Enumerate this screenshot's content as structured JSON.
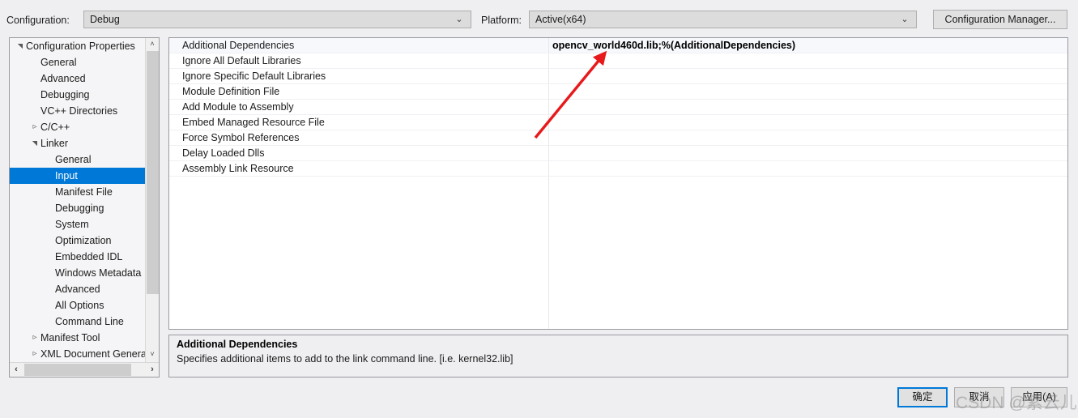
{
  "header": {
    "configuration_label": "Configuration:",
    "configuration_value": "Debug",
    "platform_label": "Platform:",
    "platform_value": "Active(x64)",
    "configuration_manager_button": "Configuration Manager...",
    "dropdown_arrow": "⌄"
  },
  "sidebar": {
    "items": [
      {
        "label": "Configuration Properties",
        "indent": 0,
        "twisty": "expanded",
        "selected": false
      },
      {
        "label": "General",
        "indent": 1,
        "twisty": "none",
        "selected": false
      },
      {
        "label": "Advanced",
        "indent": 1,
        "twisty": "none",
        "selected": false
      },
      {
        "label": "Debugging",
        "indent": 1,
        "twisty": "none",
        "selected": false
      },
      {
        "label": "VC++ Directories",
        "indent": 1,
        "twisty": "none",
        "selected": false
      },
      {
        "label": "C/C++",
        "indent": 1,
        "twisty": "collapsed",
        "selected": false
      },
      {
        "label": "Linker",
        "indent": 1,
        "twisty": "expanded",
        "selected": false
      },
      {
        "label": "General",
        "indent": 2,
        "twisty": "none",
        "selected": false
      },
      {
        "label": "Input",
        "indent": 2,
        "twisty": "none",
        "selected": true
      },
      {
        "label": "Manifest File",
        "indent": 2,
        "twisty": "none",
        "selected": false
      },
      {
        "label": "Debugging",
        "indent": 2,
        "twisty": "none",
        "selected": false
      },
      {
        "label": "System",
        "indent": 2,
        "twisty": "none",
        "selected": false
      },
      {
        "label": "Optimization",
        "indent": 2,
        "twisty": "none",
        "selected": false
      },
      {
        "label": "Embedded IDL",
        "indent": 2,
        "twisty": "none",
        "selected": false
      },
      {
        "label": "Windows Metadata",
        "indent": 2,
        "twisty": "none",
        "selected": false
      },
      {
        "label": "Advanced",
        "indent": 2,
        "twisty": "none",
        "selected": false
      },
      {
        "label": "All Options",
        "indent": 2,
        "twisty": "none",
        "selected": false
      },
      {
        "label": "Command Line",
        "indent": 2,
        "twisty": "none",
        "selected": false
      },
      {
        "label": "Manifest Tool",
        "indent": 1,
        "twisty": "collapsed",
        "selected": false
      },
      {
        "label": "XML Document Generator",
        "indent": 1,
        "twisty": "collapsed",
        "selected": false
      }
    ],
    "scroll_up_icon": "˄",
    "scroll_down_icon": "˅",
    "scroll_left_icon": "‹",
    "scroll_right_icon": "›"
  },
  "grid": {
    "rows": [
      {
        "name": "Additional Dependencies",
        "value": "opencv_world460d.lib;%(AdditionalDependencies)",
        "selected": true
      },
      {
        "name": "Ignore All Default Libraries",
        "value": "",
        "selected": false
      },
      {
        "name": "Ignore Specific Default Libraries",
        "value": "",
        "selected": false
      },
      {
        "name": "Module Definition File",
        "value": "",
        "selected": false
      },
      {
        "name": "Add Module to Assembly",
        "value": "",
        "selected": false
      },
      {
        "name": "Embed Managed Resource File",
        "value": "",
        "selected": false
      },
      {
        "name": "Force Symbol References",
        "value": "",
        "selected": false
      },
      {
        "name": "Delay Loaded Dlls",
        "value": "",
        "selected": false
      },
      {
        "name": "Assembly Link Resource",
        "value": "",
        "selected": false
      }
    ]
  },
  "description": {
    "title": "Additional Dependencies",
    "text": "Specifies additional items to add to the link command line. [i.e. kernel32.lib]"
  },
  "footer": {
    "ok_button": "确定",
    "cancel_button": "取消",
    "apply_button": "应用(A)"
  },
  "annotation": {
    "arrow_color": "#e8191b"
  },
  "watermark": {
    "text": "CSDN @紫云儿是"
  },
  "colors": {
    "accent": "#0078d7",
    "dialog_bg": "#efeff2",
    "panel_bg": "#ffffff",
    "border": "#9a9aa0",
    "selection": "#0078d7"
  }
}
